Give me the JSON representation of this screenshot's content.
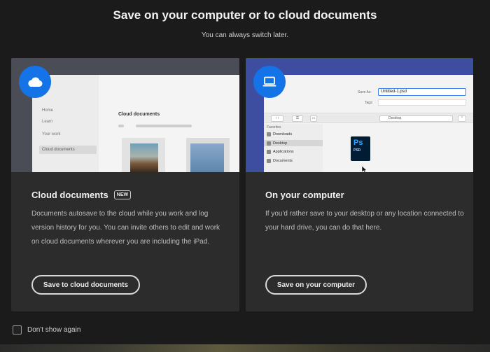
{
  "header": {
    "title": "Save on your computer or to cloud documents",
    "subtitle": "You can always switch later."
  },
  "cards": {
    "cloud": {
      "icon": "cloud-icon",
      "title": "Cloud documents",
      "badge": "NEW",
      "description": "Documents autosave to the cloud while you work and log version history for you. You can invite others to edit and work on cloud documents wherever you are including the iPad.",
      "button_label": "Save to cloud documents",
      "preview": {
        "sidebar_items": [
          "Home",
          "Learn",
          "Your work",
          "Cloud documents"
        ],
        "heading": "Cloud documents"
      }
    },
    "local": {
      "icon": "laptop-icon",
      "title": "On your computer",
      "description": "If you'd rather save to your desktop or any location connected to your hard drive, you can do that here.",
      "button_label": "Save on your computer",
      "preview": {
        "save_as_label": "Save As:",
        "save_as_value": "Untitled-1.psd",
        "tags_label": "Tags:",
        "location": "Desktop",
        "favorites_label": "Favorites",
        "sidebar_items": [
          "Downloads",
          "Desktop",
          "Applications",
          "Documents"
        ],
        "file_icon_text": "Ps",
        "file_icon_sub": "PSD"
      }
    }
  },
  "footer": {
    "dont_show_label": "Don't show again"
  },
  "colors": {
    "background": "#1b1b1b",
    "card": "#2c2c2c",
    "accent": "#1473e6"
  }
}
